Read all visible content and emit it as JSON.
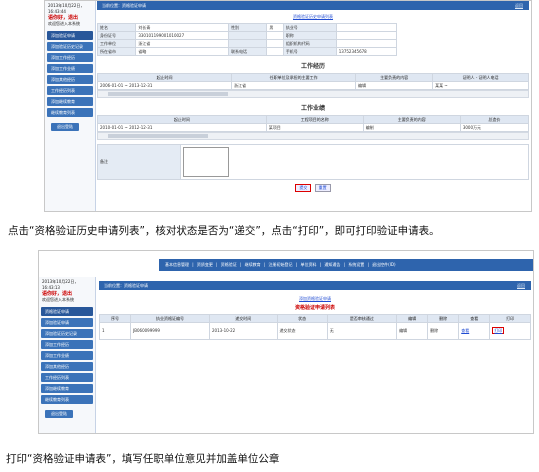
{
  "shot1": {
    "sidebar": {
      "date": "2013年10月22日，",
      "time": "16:43:44",
      "user": "语你好，退出",
      "welcome": "欢迎您进入本系统",
      "items": [
        "添加验证申请",
        "添加验证历史记录",
        "添加工作经历",
        "添加工作业绩",
        "添加其他经历",
        "工作经历列表",
        "添加继续教育",
        "继续教育列表"
      ],
      "button": "退出登陆"
    },
    "breadcrumb": "当前位置：资格验证申请",
    "breadcrumb_right": "返回",
    "top_link": "资格验证历史申请列表",
    "info_labels": [
      "姓名",
      "身份证号",
      "工作单位",
      "所在省市",
      "性别",
      "职称",
      "组织机构代码",
      "联系电话"
    ],
    "info_values": {
      "name": "刘长青",
      "id": "330101199001010027",
      "unit": "浙江省",
      "province": "省略",
      "gender": "男",
      "phone_label": "手机号",
      "phone": "13752345678",
      "mgmt_label": "执业号",
      "city": "联系电话"
    },
    "work_title": "工作经历",
    "work_headers": [
      "起止时间",
      "任职单位及承担的主要工作",
      "主要负责的内容",
      "证明人 - 证明人电话"
    ],
    "work_row": [
      "2006-01-01 ~ 2013-12-31",
      "浙江省",
      "编辑",
      "某某 ~"
    ],
    "perf_title": "工作业绩",
    "perf_headers": [
      "起止时间",
      "工程项目的名称",
      "主要负责的内容",
      "总造价"
    ],
    "perf_row": [
      "2010-01-01 ~ 2012-12-31",
      "某项目",
      "编制",
      "3000万元"
    ],
    "remark_label": "备注",
    "submit": "提交",
    "reset": "重置"
  },
  "caption1": "点击“资格验证历史申请列表”，核对状态是否为“递交”，点击“打印”，即可打印验证申请表。",
  "shot2": {
    "menu": "基本信息管理 | 资质变更 | 资格验证 | 继续教育 | 注册初始登记 | 单位资料 | 通知通告 | 系统设置 | 退出控件(ID)",
    "sidebar": {
      "date": "2013年10月22日，",
      "time": "16:43:13",
      "user": "语你好，退出",
      "welcome": "欢迎您进入本系统",
      "items": [
        "资格验证申请",
        "添加验证申请",
        "添加验证历史记录",
        "添加工作经历",
        "添加工作业绩",
        "添加其他经历",
        "工作经历列表",
        "添加继续教育",
        "继续教育列表"
      ],
      "button": "退出登陆"
    },
    "breadcrumb": "当前位置：资格验证申请",
    "breadcrumb_right": "返回",
    "link": "添加资格验证申请",
    "list_title": "资格验证申请列表",
    "headers": [
      "序号",
      "执业资格证编号",
      "递交时间",
      "状态",
      "是否审核通过",
      "编辑",
      "删除",
      "查看",
      "打印"
    ],
    "row": [
      "1",
      "JB060099999",
      "2013-10-22",
      "递交状态",
      "无",
      "编辑",
      "删除",
      "查看",
      "打印"
    ]
  },
  "caption2": "打印“资格验证申请表”，填写任职单位意见并加盖单位公章"
}
